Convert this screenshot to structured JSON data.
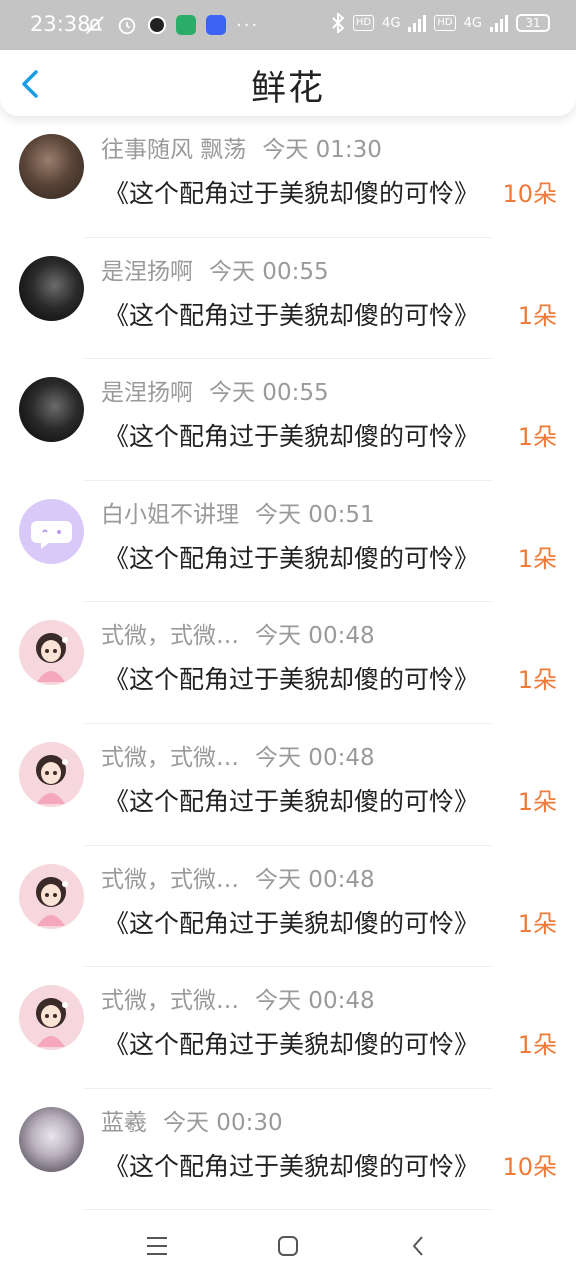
{
  "status_bar": {
    "time": "23:38",
    "left_icons": [
      "mute-bell-icon",
      "alarm-icon",
      "dark-app-icon",
      "wechat-icon",
      "baidu-icon",
      "more-dots-icon"
    ],
    "dots": "···",
    "network_badge_1": "HD",
    "network_type_1": "4G",
    "network_badge_2": "HD",
    "network_type_2": "4G",
    "battery": "31"
  },
  "header": {
    "title": "鲜花",
    "back_icon": "chevron-left-icon"
  },
  "colors": {
    "accent": "#1a9ce8",
    "count": "#ef7b3b",
    "meta": "#9a9a9a"
  },
  "items": [
    {
      "name": "往事随风 飘荡",
      "time": "今天 01:30",
      "book": "《这个配角过于美貌却傻的可怜》",
      "count": "10朵",
      "avatar": "photo-avatar"
    },
    {
      "name": "是涅扬啊",
      "time": "今天 00:55",
      "book": "《这个配角过于美貌却傻的可怜》",
      "count": "1朵",
      "avatar": "dark-avatar"
    },
    {
      "name": "是涅扬啊",
      "time": "今天 00:55",
      "book": "《这个配角过于美貌却傻的可怜》",
      "count": "1朵",
      "avatar": "dark-avatar"
    },
    {
      "name": "白小姐不讲理",
      "time": "今天 00:51",
      "book": "《这个配角过于美貌却傻的可怜》",
      "count": "1朵",
      "avatar": "chat-bubble-avatar"
    },
    {
      "name": "式微，式微…",
      "time": "今天 00:48",
      "book": "《这个配角过于美貌却傻的可怜》",
      "count": "1朵",
      "avatar": "anime-girl-avatar"
    },
    {
      "name": "式微，式微…",
      "time": "今天 00:48",
      "book": "《这个配角过于美貌却傻的可怜》",
      "count": "1朵",
      "avatar": "anime-girl-avatar"
    },
    {
      "name": "式微，式微…",
      "time": "今天 00:48",
      "book": "《这个配角过于美貌却傻的可怜》",
      "count": "1朵",
      "avatar": "anime-girl-avatar"
    },
    {
      "name": "式微，式微…",
      "time": "今天 00:48",
      "book": "《这个配角过于美貌却傻的可怜》",
      "count": "1朵",
      "avatar": "anime-girl-avatar"
    },
    {
      "name": "蓝羲",
      "time": "今天 00:30",
      "book": "《这个配角过于美貌却傻的可怜》",
      "count": "10朵",
      "avatar": "photo-avatar"
    }
  ],
  "navbar": {
    "icons": [
      "menu-icon",
      "home-icon",
      "back-icon"
    ]
  }
}
